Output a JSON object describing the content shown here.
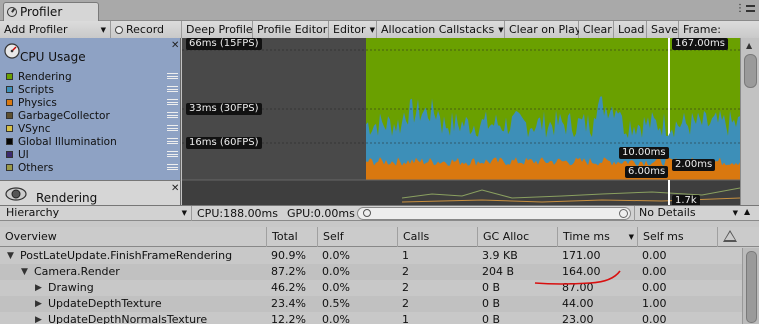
{
  "window": {
    "tab_label": "Profiler"
  },
  "toolbar": {
    "add_profiler": "Add Profiler",
    "record": "Record",
    "deep_profile": "Deep Profile",
    "profile_editor": "Profile Editor",
    "editor": "Editor",
    "allocation_callstacks": "Allocation Callstacks",
    "clear_on_play": "Clear on Play",
    "clear": "Clear",
    "load": "Load",
    "save": "Save",
    "frame": "Frame:"
  },
  "cpu_panel": {
    "title": "CPU Usage",
    "legend": [
      {
        "label": "Rendering",
        "color": "#6aa000"
      },
      {
        "label": "Scripts",
        "color": "#3d8fb8"
      },
      {
        "label": "Physics",
        "color": "#d9780f"
      },
      {
        "label": "GarbageCollector",
        "color": "#5e5030"
      },
      {
        "label": "VSync",
        "color": "#d6c046"
      },
      {
        "label": "Global Illumination",
        "color": "#050505"
      },
      {
        "label": "UI",
        "color": "#3c2a6e"
      },
      {
        "label": "Others",
        "color": "#9a9a48"
      }
    ]
  },
  "render_panel": {
    "title": "Rendering"
  },
  "chart": {
    "labels": {
      "ms66": "66ms (15FPS)",
      "ms33": "33ms (30FPS)",
      "ms16": "16ms (60FPS)",
      "selected": "167.00ms",
      "v10": "10.00ms",
      "v6": "6.00ms",
      "v2": "2.00ms",
      "render_val": "1.7k"
    },
    "colors": {
      "rendering": "#6aa000",
      "scripts": "#3d8fb8",
      "physics": "#d9780f",
      "bg": "#494949"
    }
  },
  "hierarchy_bar": {
    "view": "Hierarchy",
    "cpu": "CPU:188.00ms",
    "gpu": "GPU:0.00ms",
    "search_placeholder": "",
    "details": "No Details"
  },
  "table": {
    "columns": [
      "Overview",
      "Total",
      "Self",
      "Calls",
      "GC Alloc",
      "Time ms",
      "Self ms"
    ],
    "rows": [
      {
        "name": "PostLateUpdate.FinishFrameRendering",
        "total": "90.9%",
        "self": "0.0%",
        "calls": "1",
        "gc": "3.9 KB",
        "time": "171.00",
        "selfms": "0.00",
        "expander": "down",
        "depth": 0
      },
      {
        "name": "Camera.Render",
        "total": "87.2%",
        "self": "0.0%",
        "calls": "2",
        "gc": "204 B",
        "time": "164.00",
        "selfms": "0.00",
        "expander": "down",
        "depth": 1
      },
      {
        "name": "Drawing",
        "total": "46.2%",
        "self": "0.0%",
        "calls": "2",
        "gc": "0 B",
        "time": "87.00",
        "selfms": "0.00",
        "expander": "right",
        "depth": 2
      },
      {
        "name": "UpdateDepthTexture",
        "total": "23.4%",
        "self": "0.5%",
        "calls": "2",
        "gc": "0 B",
        "time": "44.00",
        "selfms": "1.00",
        "expander": "right",
        "depth": 2
      },
      {
        "name": "UpdateDepthNormalsTexture",
        "total": "12.2%",
        "self": "0.0%",
        "calls": "1",
        "gc": "0 B",
        "time": "23.00",
        "selfms": "0.00",
        "expander": "right",
        "depth": 2
      }
    ]
  }
}
